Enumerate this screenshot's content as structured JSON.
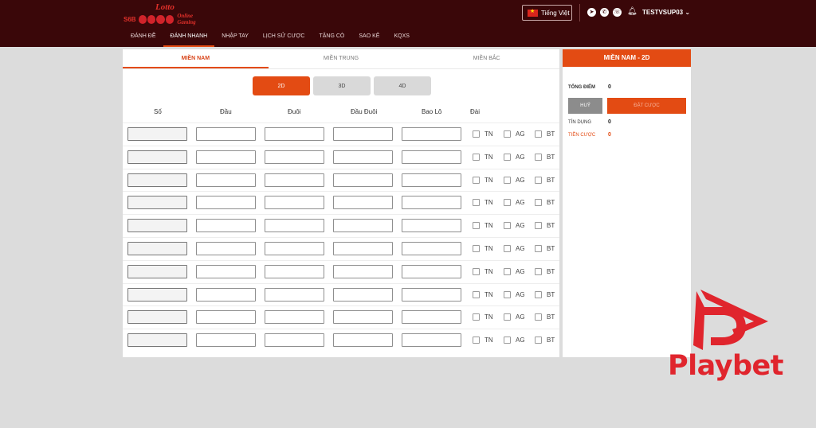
{
  "header": {
    "logo_brand": "Lotto",
    "logo_prefix": "S6B",
    "logo_suffix": "Online Gaming",
    "language": "Tiếng Việt",
    "username": "TESTVSUP03"
  },
  "nav": {
    "items": [
      "ĐÁNH ĐỀ",
      "ĐÁNH NHANH",
      "NHẬP TAY",
      "LỊCH SỬ CƯỢC",
      "TẶNG CÒ",
      "SAO KÊ",
      "KQXS"
    ],
    "active_index": 1
  },
  "regions": {
    "tabs": [
      "MIỀN NAM",
      "MIỀN TRUNG",
      "MIỀN BẮC"
    ],
    "active_index": 0
  },
  "modes": {
    "buttons": [
      "2D",
      "3D",
      "4D"
    ],
    "active_index": 0
  },
  "table": {
    "headers": [
      "Số",
      "Đầu",
      "Đuôi",
      "Đầu Đuôi",
      "Bao Lô",
      "Đài"
    ],
    "stations": [
      "TN",
      "AG",
      "BT"
    ],
    "row_count": 10
  },
  "panel": {
    "title": "MIỀN NAM - 2D",
    "total_points_label": "TỔNG ĐIỂM",
    "total_points_value": "0",
    "cancel_label": "HUỶ",
    "place_bet_label": "ĐẶT CƯỢC",
    "credit_label": "TÍN DỤNG",
    "credit_value": "0",
    "bet_money_label": "TIỀN CƯỢC",
    "bet_money_value": "0"
  },
  "watermark": {
    "text": "Playbet"
  },
  "colors": {
    "header_bg": "#3a0709",
    "accent": "#e34b13",
    "watermark": "#e0252d"
  }
}
